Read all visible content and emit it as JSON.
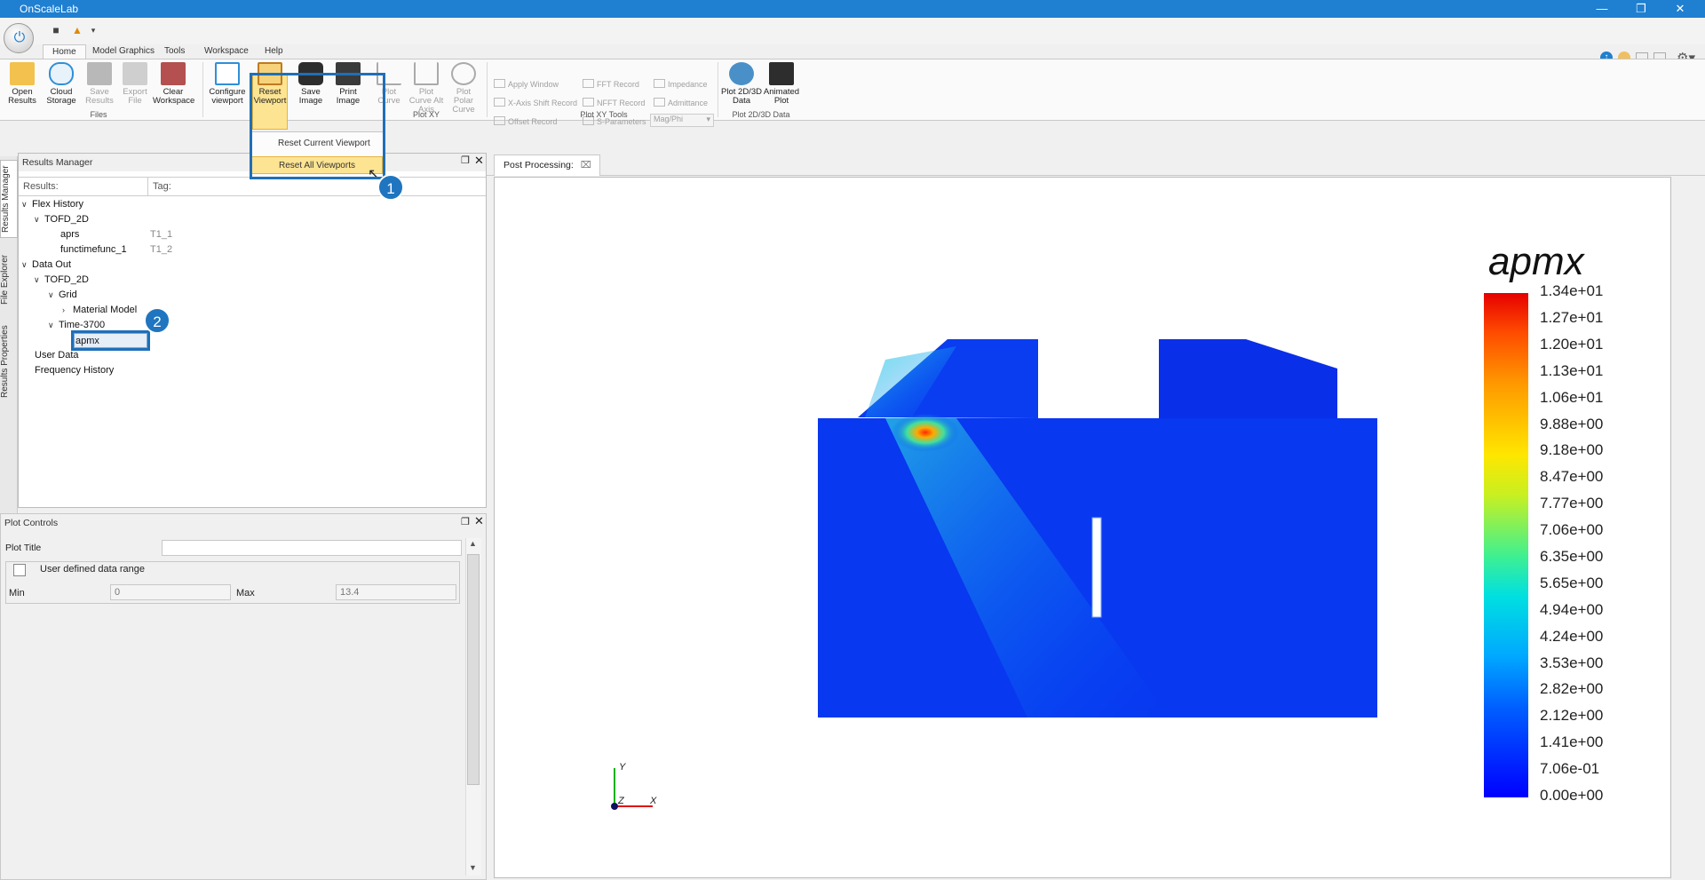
{
  "app": {
    "title": "OnScaleLab"
  },
  "ribbon_tabs": [
    "Home",
    "Model Graphics",
    "Tools",
    "Workspace",
    "Help"
  ],
  "ribbon": {
    "files": {
      "open_results": "Open Results",
      "cloud_storage": "Cloud Storage",
      "save_results": "Save Results",
      "export_file": "Export File",
      "clear_workspace": "Clear Workspace",
      "group": "Files"
    },
    "view": {
      "configure_viewport": "Configure viewport",
      "reset_viewport": "Reset Viewport",
      "save_image": "Save Image",
      "print_image": "Print Image"
    },
    "plotxy": {
      "plot_curve": "Plot Curve",
      "plot_curve_alt": "Plot Curve Alt Axis",
      "plot_polar": "Plot Polar Curve",
      "group": "Plot XY"
    },
    "tools": {
      "apply_window": "Apply Window",
      "x_axis_shift": "X-Axis Shift Record",
      "offset_record": "Offset Record",
      "fft_record": "FFT Record",
      "nfft_record": "NFFT Record",
      "s_parameters": "S-Parameters",
      "impedance": "Impedance",
      "admittance": "Admittance",
      "mag_phi": "Mag/Phi",
      "group": "Plot XY Tools"
    },
    "plot2d3d": {
      "plot_data": "Plot 2D/3D Data",
      "animated_plot": "Animated Plot",
      "group": "Plot 2D/3D Data"
    }
  },
  "dropdown": {
    "items": [
      "Reset Current Viewport",
      "Reset All Viewports"
    ]
  },
  "callouts": [
    "1",
    "2"
  ],
  "side_tabs": [
    "Results Manager",
    "File Explorer",
    "Results Properties"
  ],
  "results_manager": {
    "title": "Results Manager",
    "col_results": "Results:",
    "col_tag": "Tag:",
    "tree": [
      {
        "label": "Flex History",
        "tag": ""
      },
      {
        "label": "TOFD_2D",
        "tag": ""
      },
      {
        "label": "aprs",
        "tag": "T1_1"
      },
      {
        "label": "functimefunc_1",
        "tag": "T1_2"
      },
      {
        "label": "Data Out",
        "tag": ""
      },
      {
        "label": "TOFD_2D",
        "tag": ""
      },
      {
        "label": "Grid",
        "tag": ""
      },
      {
        "label": "Material Model",
        "tag": ""
      },
      {
        "label": "Time-3700",
        "tag": ""
      },
      {
        "label": "apmx",
        "tag": ""
      },
      {
        "label": "User Data",
        "tag": ""
      },
      {
        "label": "Frequency History",
        "tag": ""
      }
    ]
  },
  "plot_controls": {
    "title": "Plot Controls",
    "plot_title_label": "Plot Title",
    "plot_title_value": "",
    "user_range_label": "User defined data range",
    "min_label": "Min",
    "min_value": "0",
    "max_label": "Max",
    "max_value": "13.4"
  },
  "view_tab": {
    "label": "Post Processing:"
  },
  "legend": {
    "title": "apmx",
    "labels": [
      "1.34e+01",
      "1.27e+01",
      "1.20e+01",
      "1.13e+01",
      "1.06e+01",
      "9.88e+00",
      "9.18e+00",
      "8.47e+00",
      "7.77e+00",
      "7.06e+00",
      "6.35e+00",
      "5.65e+00",
      "4.94e+00",
      "4.24e+00",
      "3.53e+00",
      "2.82e+00",
      "2.12e+00",
      "1.41e+00",
      "7.06e-01",
      "0.00e+00"
    ]
  },
  "axes": {
    "y": "Y",
    "z": "Z",
    "x": "X"
  }
}
